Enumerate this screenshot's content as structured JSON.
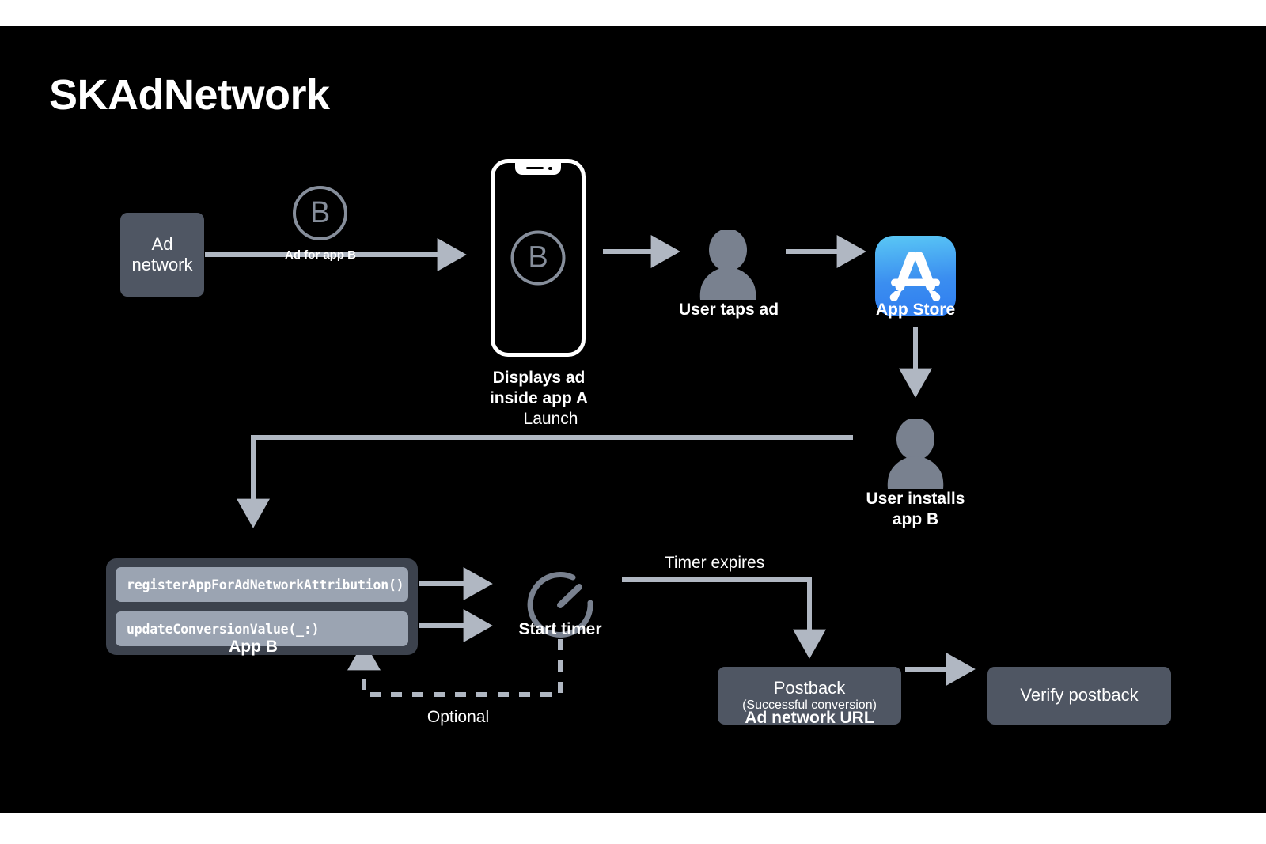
{
  "page": {
    "title": "SKAdNetwork",
    "background": "#000000",
    "frame_background": "#ffffff"
  },
  "colors": {
    "canvas": "#000000",
    "box_fill": "#4f5663",
    "code_container_fill": "#3c424d",
    "code_chip_fill": "#9ba4b2",
    "arrow": "#b0b7c2",
    "silhouette": "#79818f",
    "b_mark": "#868e9b",
    "text": "#ffffff",
    "appstore_blue_light": "#5ac8f5",
    "appstore_blue_dark": "#2e7cf0"
  },
  "nodes": {
    "ad_network": {
      "label": "Ad\nnetwork",
      "name": "ad-network-box"
    },
    "ad_for_app_b": {
      "label": "Ad for app B",
      "icon": "circled-b-icon",
      "icon_letter": "B"
    },
    "phone": {
      "caption": "Displays ad\ninside app A",
      "screen_icon_letter": "B",
      "icon": "iphone-icon"
    },
    "user_taps_ad": {
      "caption": "User taps ad",
      "icon": "person-icon"
    },
    "app_store": {
      "caption": "App Store",
      "icon": "app-store-icon"
    },
    "user_installs_app_b": {
      "caption": "User installs\napp B",
      "icon": "person-icon"
    },
    "app_b": {
      "caption": "App B",
      "api_calls": [
        "registerAppForAdNetworkAttribution()",
        "updateConversionValue(_:)"
      ]
    },
    "start_timer": {
      "caption": "Start timer",
      "icon": "stopwatch-icon"
    },
    "postback": {
      "title": "Postback",
      "subtitle": "(Successful conversion)",
      "caption": "Ad network URL"
    },
    "verify_postback": {
      "label": "Verify postback"
    }
  },
  "edges": {
    "ad_network_to_phone": {
      "label": ""
    },
    "phone_to_user": {
      "label": ""
    },
    "user_to_appstore": {
      "label": ""
    },
    "appstore_to_install": {
      "label": ""
    },
    "install_to_app_b": {
      "label": "Launch"
    },
    "app_b_to_timer_1": {
      "label": ""
    },
    "app_b_to_timer_2": {
      "label": ""
    },
    "timer_to_postback": {
      "label": "Timer expires"
    },
    "postback_to_verify": {
      "label": ""
    },
    "timer_to_app_b_optional": {
      "label": "Optional",
      "style": "dashed"
    }
  }
}
